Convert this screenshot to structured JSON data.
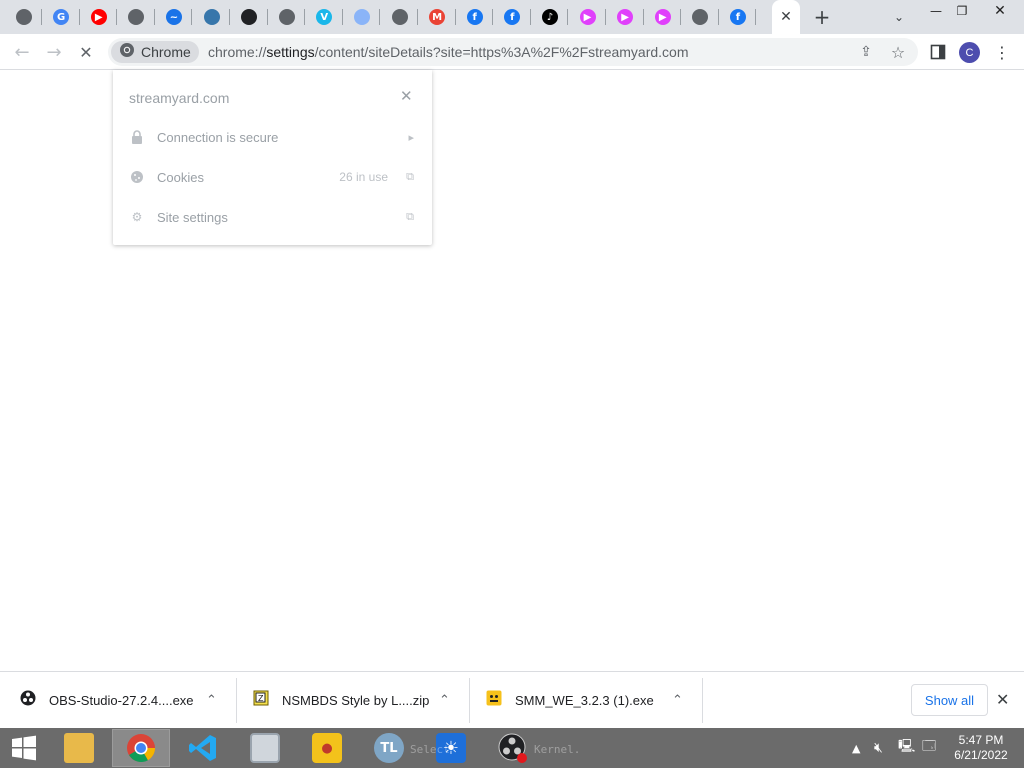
{
  "tabs": [
    {
      "icon": "globe-icon",
      "glyph": "",
      "color": "#5f6368"
    },
    {
      "icon": "google-icon",
      "glyph": "G",
      "color": "#4285f4"
    },
    {
      "icon": "youtube-icon",
      "glyph": "▶",
      "color": "#ff0000"
    },
    {
      "icon": "globe-icon",
      "glyph": "",
      "color": "#5f6368"
    },
    {
      "icon": "wave-app-icon",
      "glyph": "~",
      "color": "#1a73e8"
    },
    {
      "icon": "python-icon",
      "glyph": "",
      "color": "#3776ab"
    },
    {
      "icon": "obs-icon",
      "glyph": "",
      "color": "#202124"
    },
    {
      "icon": "globe-icon",
      "glyph": "",
      "color": "#5f6368"
    },
    {
      "icon": "vimeo-icon",
      "glyph": "V",
      "color": "#1ab7ea"
    },
    {
      "icon": "loading-spinner-icon",
      "glyph": "",
      "color": "#8ab4f8"
    },
    {
      "icon": "chrome-icon",
      "glyph": "",
      "color": "#5f6368"
    },
    {
      "icon": "gmail-icon",
      "glyph": "M",
      "color": "#ea4335"
    },
    {
      "icon": "facebook-icon",
      "glyph": "f",
      "color": "#1877f2"
    },
    {
      "icon": "facebook-icon",
      "glyph": "f",
      "color": "#1877f2"
    },
    {
      "icon": "tiktok-icon",
      "glyph": "♪",
      "color": "#000000"
    },
    {
      "icon": "google-play-icon",
      "glyph": "▶",
      "color": "#e040fb"
    },
    {
      "icon": "google-play-icon",
      "glyph": "▶",
      "color": "#e040fb"
    },
    {
      "icon": "google-play-icon",
      "glyph": "▶",
      "color": "#e040fb"
    },
    {
      "icon": "chrome-icon",
      "glyph": "",
      "color": "#5f6368"
    },
    {
      "icon": "facebook-icon",
      "glyph": "f",
      "color": "#1877f2"
    }
  ],
  "toolbar": {
    "chip_label": "Chrome",
    "url_prefix": "chrome://",
    "url_host": "settings",
    "url_rest": "/content/siteDetails?site=https%3A%2F%2Fstreamyard.com",
    "avatar_letter": "C"
  },
  "popup": {
    "title": "streamyard.com",
    "rows": [
      {
        "label": "Connection is secure",
        "icon": "lock-icon",
        "meta": ""
      },
      {
        "label": "Cookies",
        "icon": "cookie-icon",
        "meta": "26 in use"
      },
      {
        "label": "Site settings",
        "icon": "gear-icon",
        "meta": ""
      }
    ]
  },
  "downloads": {
    "items": [
      {
        "name": "OBS-Studio-27.2.4....exe",
        "icon": "obs-icon"
      },
      {
        "name": "NSMBDS Style by L....zip",
        "icon": "zip-archive-icon"
      },
      {
        "name": "SMM_WE_3.2.3 (1).exe",
        "icon": "smm-app-icon"
      }
    ],
    "show_all": "Show all"
  },
  "taskbar": {
    "clock_time": "5:47 PM",
    "clock_date": "6/21/2022",
    "ghost_texts": [
      "Select",
      "Kernel."
    ]
  },
  "colors": {
    "tabstrip_bg": "#dee1e6",
    "accent": "#1a73e8",
    "taskbar_bg": "#6b6b6b"
  }
}
